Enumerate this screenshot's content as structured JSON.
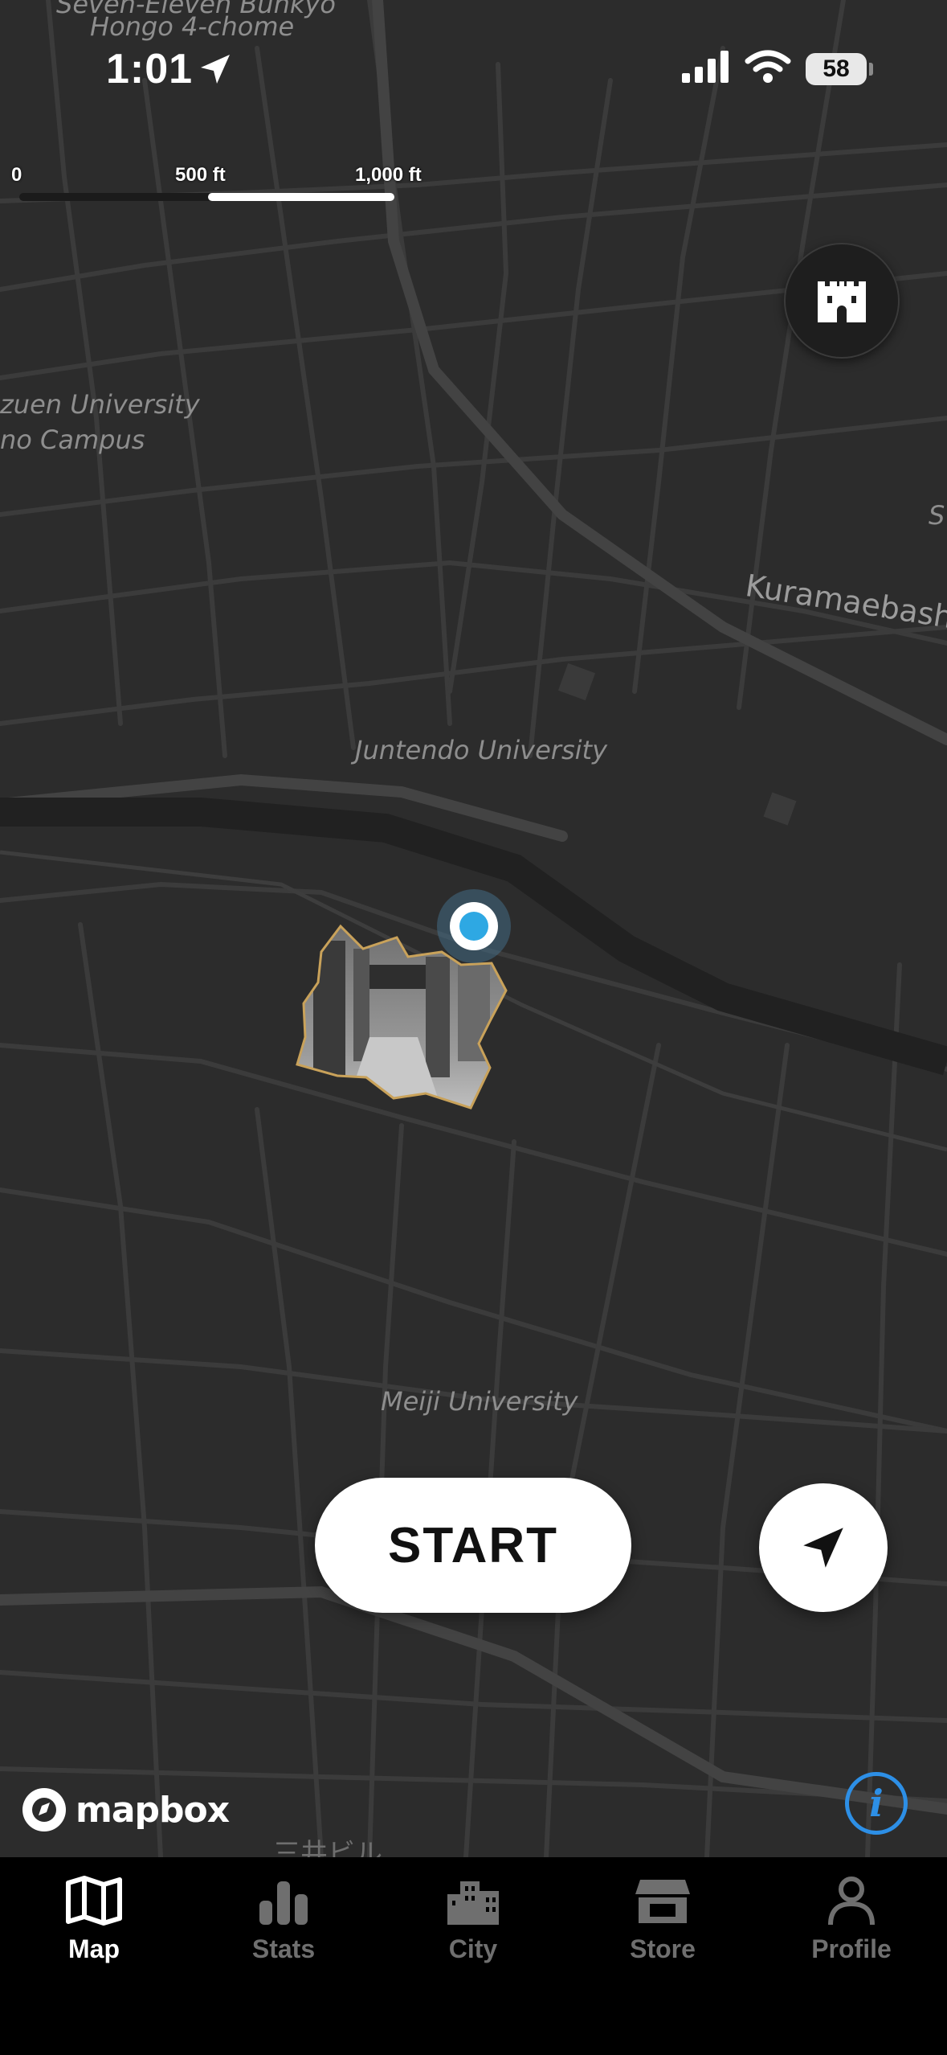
{
  "status_bar": {
    "time": "1:01",
    "battery": "58"
  },
  "map": {
    "scale": {
      "labels": [
        "0",
        "500 ft",
        "1,000 ft"
      ]
    },
    "place_labels": {
      "top_partial": "Seven-Eleven Bunkyo",
      "hongo": "Hongo 4-chome",
      "univ_line1": "zuen University",
      "univ_line2": "no Campus",
      "road": "Kuramaebash",
      "edge_s": "S",
      "juntendo": "Juntendo University",
      "meiji": "Meiji University",
      "bottom": "三井ビル"
    },
    "attribution": "mapbox"
  },
  "buttons": {
    "start": "START",
    "info": "i"
  },
  "tabs": [
    {
      "label": "Map",
      "icon": "map-icon",
      "active": true
    },
    {
      "label": "Stats",
      "icon": "bar-chart-icon",
      "active": false
    },
    {
      "label": "City",
      "icon": "city-icon",
      "active": false
    },
    {
      "label": "Store",
      "icon": "store-icon",
      "active": false
    },
    {
      "label": "Profile",
      "icon": "person-icon",
      "active": false
    }
  ],
  "colors": {
    "accent_blue": "#2ea8e3",
    "info_blue": "#2d8fe6",
    "territory_outline": "#c9a25a"
  }
}
